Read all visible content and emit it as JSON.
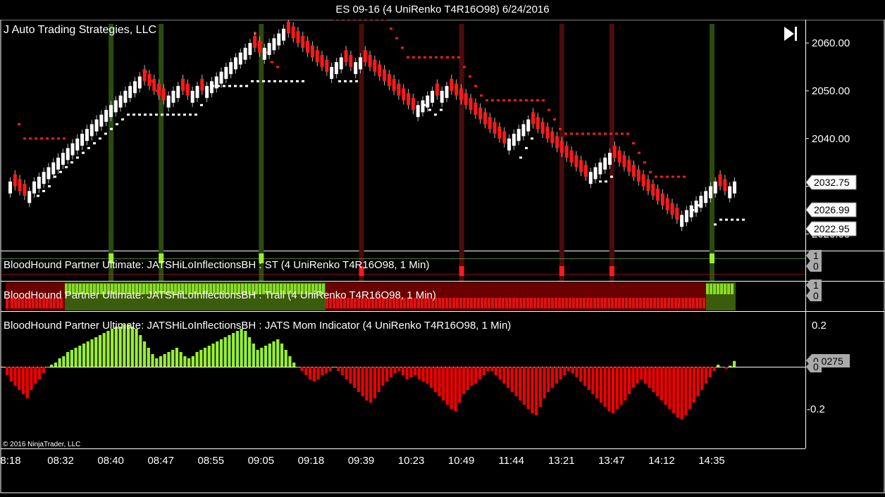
{
  "window": {
    "title": "ES 09-16 (4 UniRenko T4R16O98)  6/24/2016"
  },
  "chart_data": {
    "type": "line",
    "title": "ES 09-16 (4 UniRenko T4R16O98)  6/24/2016",
    "watermark": "J Auto Trading Strategies, LLC",
    "copyright": "© 2016 NinjaTrader, LLC",
    "time_labels": [
      "8:18",
      "08:32",
      "08:40",
      "08:47",
      "08:55",
      "09:05",
      "09:18",
      "09:39",
      "10:23",
      "10:49",
      "11:44",
      "13:21",
      "13:47",
      "14:12",
      "14:35"
    ],
    "price_axis": {
      "ticks": [
        "2060.00",
        "2050.00",
        "2040.00",
        "2030.00",
        "2020.00"
      ],
      "ylim": [
        2018,
        2064
      ]
    },
    "price_tags": [
      "2032.75",
      "2026.99",
      "2022.95"
    ],
    "price_close": [
      2031,
      2030,
      2029,
      2028,
      2029,
      2031,
      2032,
      2033,
      2034,
      2035,
      2036,
      2037,
      2038,
      2039,
      2040,
      2041,
      2042,
      2043,
      2044,
      2045,
      2046,
      2047,
      2048,
      2049,
      2050,
      2051,
      2052,
      2053,
      2052,
      2051,
      2050,
      2049,
      2048,
      2049,
      2050,
      2051,
      2050,
      2049,
      2050,
      2051,
      2050,
      2051,
      2052,
      2053,
      2054,
      2055,
      2056,
      2057,
      2058,
      2059,
      2060,
      2059,
      2058,
      2059,
      2060,
      2061,
      2062,
      2063,
      2062,
      2061,
      2060,
      2059,
      2058,
      2057,
      2056,
      2055,
      2054,
      2055,
      2056,
      2057,
      2056,
      2055,
      2056,
      2057,
      2056,
      2055,
      2054,
      2053,
      2052,
      2051,
      2050,
      2049,
      2048,
      2047,
      2046,
      2047,
      2048,
      2049,
      2050,
      2049,
      2050,
      2051,
      2050,
      2049,
      2048,
      2047,
      2046,
      2045,
      2044,
      2043,
      2042,
      2041,
      2040,
      2039,
      2040,
      2041,
      2042,
      2043,
      2044,
      2043,
      2042,
      2041,
      2040,
      2039,
      2038,
      2037,
      2036,
      2035,
      2034,
      2033,
      2032,
      2033,
      2034,
      2035,
      2036,
      2037,
      2036,
      2035,
      2034,
      2033,
      2032,
      2031,
      2030,
      2029,
      2028,
      2027,
      2026,
      2025,
      2024,
      2023,
      2024,
      2025,
      2026,
      2027,
      2028,
      2029,
      2030,
      2031,
      2030,
      2029,
      2030,
      2031
    ],
    "trail_red_levels": [
      [
        2043,
        2040,
        2040,
        2040,
        2040,
        2040,
        2040,
        2040,
        2040
      ],
      [
        2054,
        2052,
        2050
      ],
      [
        2062,
        2060,
        2058,
        2056,
        2055
      ],
      [
        2065,
        2065,
        2065,
        2065,
        2065,
        2065,
        2065,
        2065,
        2065,
        2065,
        2063,
        2061,
        2059,
        2057,
        2057,
        2057,
        2057,
        2057,
        2057,
        2057,
        2057,
        2057,
        2057,
        2055,
        2053,
        2051,
        2049,
        2048,
        2048,
        2048,
        2048,
        2048,
        2048,
        2048,
        2048,
        2048,
        2048,
        2048,
        2046,
        2044,
        2042,
        2041,
        2041,
        2041,
        2041,
        2041,
        2041,
        2041,
        2041,
        2041,
        2041,
        2041,
        2041,
        2039,
        2037,
        2035,
        2033,
        2032,
        2032,
        2032,
        2032,
        2032,
        2032
      ]
    ],
    "trail_white_levels": [
      [
        2028,
        2029,
        2030,
        2032,
        2033,
        2034,
        2035,
        2036,
        2037,
        2038,
        2039,
        2040,
        2041,
        2042,
        2043,
        2044,
        2045,
        2045,
        2045,
        2045,
        2045,
        2045,
        2045,
        2045,
        2045,
        2045,
        2045,
        2045,
        2045,
        2047,
        2049,
        2051,
        2051,
        2051,
        2051,
        2051,
        2051,
        2051,
        2052,
        2052,
        2052,
        2052,
        2052,
        2052,
        2052,
        2052,
        2052,
        2052
      ],
      [
        2052,
        2052,
        2052,
        2052
      ],
      [
        2047,
        2046,
        2045,
        2046
      ],
      [
        2036,
        2038,
        2040
      ],
      [
        2031,
        2031,
        2032
      ],
      [
        2023,
        2024,
        2025,
        2026
      ],
      [
        2022,
        2023,
        2023,
        2023,
        2023,
        2023
      ]
    ],
    "signal_bars": {
      "green_times": [
        "08:40",
        "08:47",
        "09:05",
        "14:35"
      ],
      "red_times": [
        "09:39",
        "10:49",
        "13:21",
        "13:47"
      ]
    },
    "panels": [
      {
        "label": "BloodHound Partner Ultimate: JATSHiLoInflectionsBH : ST (4 UniRenko T4R16O98, 1 Min)",
        "axis_tags": [
          "1",
          "0"
        ]
      },
      {
        "label": "BloodHound Partner Ultimate: JATSHiLoInflectionsBH : Trail (4 UniRenko T4R16O98, 1 Min)",
        "axis_tags": [
          "1",
          "0"
        ]
      },
      {
        "label": "BloodHound Partner Ultimate: JATSHiLoInflectionsBH : JATS Mom Indicator (4 UniRenko T4R16O98, 1 Min)",
        "axis_ticks": [
          "0.2",
          "-0.2"
        ],
        "axis_tags": [
          "0.0275",
          "0"
        ],
        "ylim": [
          -0.35,
          0.25
        ]
      }
    ],
    "momentum": [
      -0.04,
      -0.07,
      -0.09,
      -0.11,
      -0.13,
      -0.15,
      -0.11,
      -0.08,
      -0.06,
      -0.03,
      0,
      0.01,
      0.02,
      0.04,
      0.05,
      0.07,
      0.08,
      0.09,
      0.1,
      0.11,
      0.12,
      0.13,
      0.14,
      0.15,
      0.16,
      0.17,
      0.18,
      0.19,
      0.19,
      0.2,
      0.2,
      0.19,
      0.18,
      0.15,
      0.12,
      0.09,
      0.06,
      0.04,
      0.05,
      0.06,
      0.07,
      0.08,
      0.09,
      0.07,
      0.05,
      0.04,
      0.05,
      0.07,
      0.08,
      0.09,
      0.1,
      0.11,
      0.12,
      0.13,
      0.14,
      0.15,
      0.16,
      0.17,
      0.18,
      0.17,
      0.14,
      0.11,
      0.08,
      0.09,
      0.1,
      0.11,
      0.12,
      0.13,
      0.11,
      0.08,
      0.05,
      0.02,
      0,
      -0.02,
      -0.04,
      -0.06,
      -0.07,
      -0.06,
      -0.04,
      -0.03,
      -0.02,
      0,
      -0.02,
      -0.04,
      -0.06,
      -0.08,
      -0.1,
      -0.12,
      -0.14,
      -0.16,
      -0.17,
      -0.15,
      -0.12,
      -0.09,
      -0.07,
      -0.05,
      -0.03,
      -0.02,
      -0.04,
      -0.06,
      -0.05,
      -0.04,
      -0.06,
      -0.07,
      -0.08,
      -0.1,
      -0.12,
      -0.14,
      -0.16,
      -0.18,
      -0.2,
      -0.21,
      -0.17,
      -0.13,
      -0.11,
      -0.09,
      -0.08,
      -0.06,
      -0.04,
      -0.02,
      -0.02,
      -0.04,
      -0.06,
      -0.08,
      -0.1,
      -0.12,
      -0.14,
      -0.16,
      -0.18,
      -0.2,
      -0.22,
      -0.23,
      -0.19,
      -0.15,
      -0.12,
      -0.1,
      -0.08,
      -0.06,
      -0.04,
      -0.02,
      -0.03,
      -0.05,
      -0.07,
      -0.09,
      -0.11,
      -0.13,
      -0.15,
      -0.17,
      -0.19,
      -0.21,
      -0.22,
      -0.2,
      -0.18,
      -0.16,
      -0.13,
      -0.1,
      -0.08,
      -0.06,
      -0.08,
      -0.1,
      -0.12,
      -0.14,
      -0.16,
      -0.18,
      -0.2,
      -0.22,
      -0.24,
      -0.25,
      -0.23,
      -0.2,
      -0.17,
      -0.14,
      -0.11,
      -0.08,
      -0.05,
      -0.02,
      0.01,
      0,
      -0.01,
      0.005,
      0.0275
    ],
    "colors": {
      "up_candle": "#ffffff",
      "down_candle": "#ff1a1a",
      "trail_up": "#ffffff",
      "trail_down": "#ff1a1a",
      "mom_positive": "#99ee33",
      "mom_negative": "#ee0000",
      "green_signal": "#2b4a10",
      "red_signal": "#4a0c0c",
      "trail_dark_red": "#6a0000",
      "trail_dark_green": "#3b5c0a"
    }
  }
}
